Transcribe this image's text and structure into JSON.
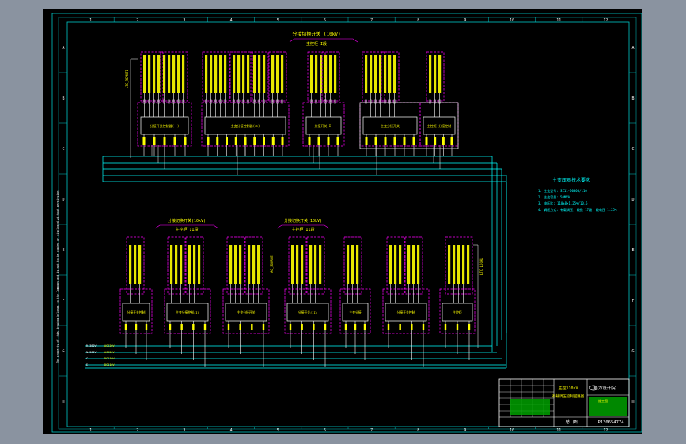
{
  "border": {
    "columns": [
      "1",
      "2",
      "3",
      "4",
      "5",
      "6",
      "7",
      "8",
      "9",
      "10",
      "11",
      "12"
    ],
    "rows": [
      "A",
      "B",
      "C",
      "D",
      "E",
      "F",
      "G",
      "H"
    ],
    "side_note": "The property of this drawing belongs to the Company and is not to be copied or disclosed without permission"
  },
  "top_section": {
    "header_title": "分接切换开关 (10kV)",
    "header_sub": "主控柜 I段",
    "modules": [
      {
        "label": "分接开关控制器(一)"
      },
      {
        "label": "主变分接控制器(二)"
      },
      {
        "label": "分接开关(I)"
      },
      {
        "label": "主变分接开关"
      },
      {
        "label": "主控柜 分接控制"
      }
    ],
    "left_tag": "LTC_REMOTE"
  },
  "bottom_section": {
    "header_left_title": "分接切换开关(10kV)",
    "header_left_sub": "主控柜 II段",
    "header_mid_title": "分接切换开关(10kV)",
    "header_mid_sub": "主控柜 II段",
    "modules": [
      {
        "label": "分接开关控制"
      },
      {
        "label": "主变分接控制(I)"
      },
      {
        "label": "主变分接开关"
      },
      {
        "label": "分接开关(II)"
      },
      {
        "label": "主变分接"
      },
      {
        "label": "分接开关控制"
      },
      {
        "label": "主控柜"
      }
    ],
    "right_tag": "LTC_LOCAL",
    "left_tag": "AC_SOURCE"
  },
  "bus_legend": [
    {
      "label": "R—380V",
      "value": "AC220V"
    },
    {
      "label": "N—380V",
      "value": "AC220V"
    },
    {
      "label": "C",
      "value": "DC110V"
    },
    {
      "label": "E",
      "value": "DC110V"
    }
  ],
  "notes": {
    "title": "主变压器技术要求",
    "lines": [
      "1. 主变型号: SZ11-50000/110",
      "2. 主变容量: 50MVA",
      "3. 电压比: 110±8×1.25%/10.5",
      "4. 调压方式: 有载调压, 级数 17级, 级电压 1.25%"
    ]
  },
  "title_block": {
    "company": "电力设计院",
    "project": "主控110kV",
    "drawing_name": "有载调压控制回路图",
    "stage": "施工图",
    "drawing_type": "总 图",
    "drawing_number": "P130654774"
  },
  "colors": {
    "background": "#000000",
    "frame": "#00c8c8",
    "boundary": "#ff00ff",
    "text": "#ffff00",
    "wire": "#ffffff",
    "bus": "#00ffff",
    "green_fill": "#00a000"
  }
}
